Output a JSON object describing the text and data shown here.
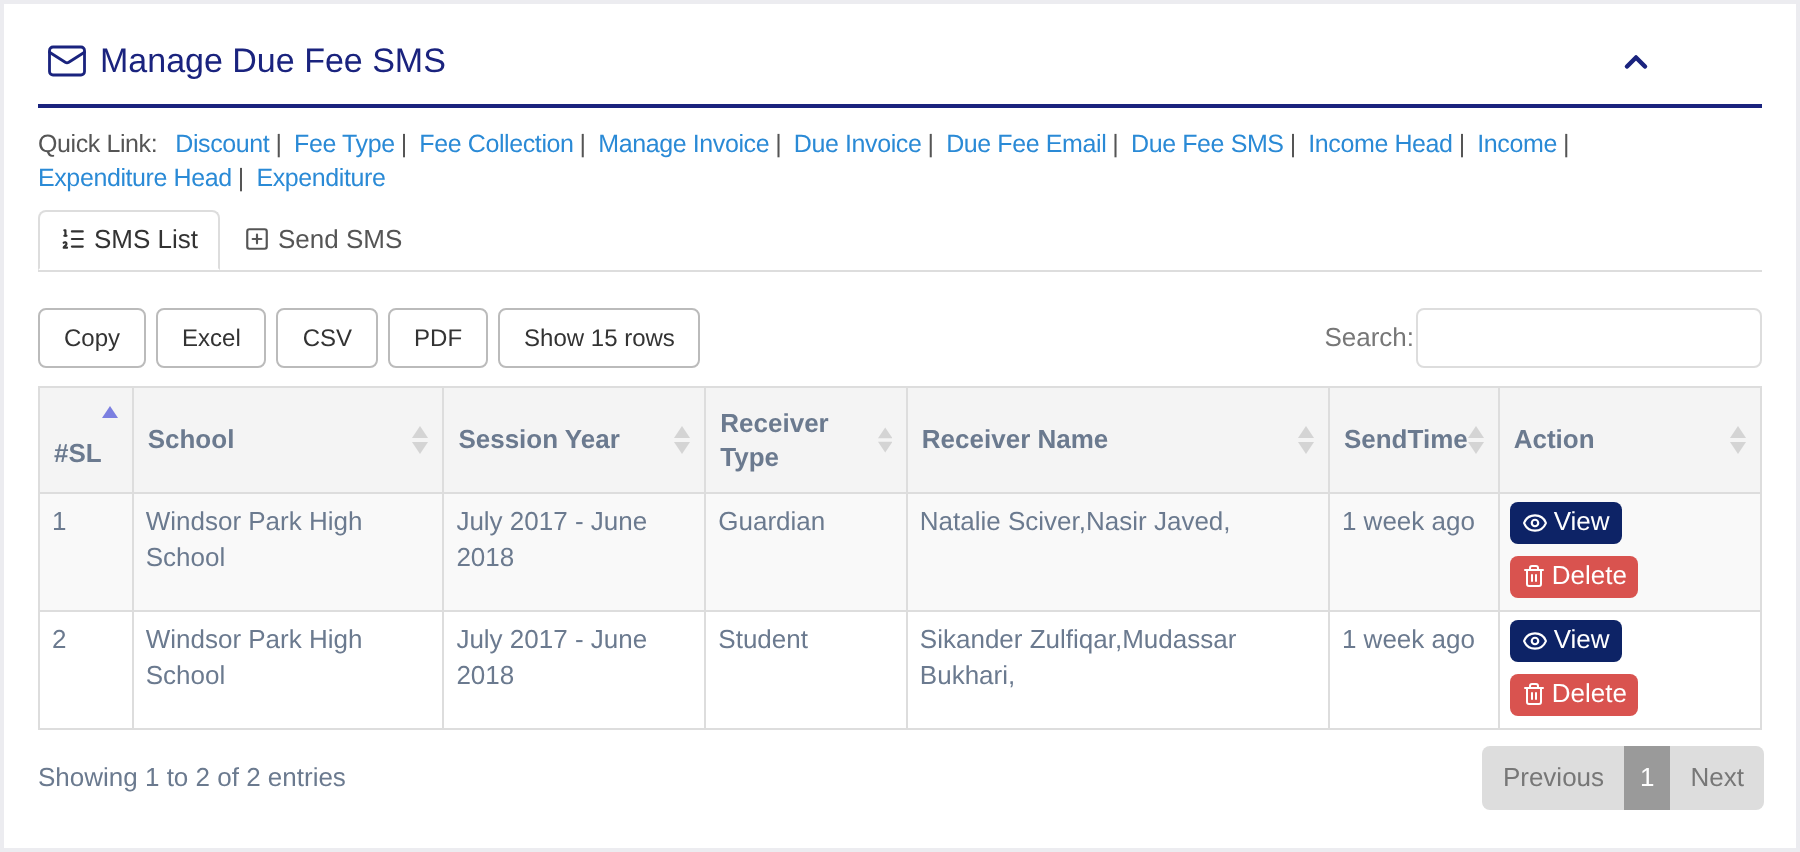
{
  "panel": {
    "title": "Manage Due Fee SMS",
    "expanded": true
  },
  "quick_links": {
    "label": "Quick Link:",
    "separator": "|",
    "links": [
      "Discount",
      "Fee Type",
      "Fee Collection",
      "Manage Invoice",
      "Due Invoice",
      "Due Fee Email",
      "Due Fee SMS",
      "Income Head",
      "Income",
      "Expenditure Head",
      "Expenditure"
    ]
  },
  "tabs": [
    {
      "label": "SMS List",
      "kind": "list",
      "selected": true
    },
    {
      "label": "Send SMS",
      "kind": "add",
      "selected": false
    }
  ],
  "export_buttons": [
    "Copy",
    "Excel",
    "CSV",
    "PDF",
    "Show 15 rows"
  ],
  "search": {
    "label": "Search:"
  },
  "table": {
    "columns": [
      {
        "label": "#SL",
        "sorted": true
      },
      {
        "label": "School",
        "sorted": false
      },
      {
        "label": "Session Year",
        "sorted": false
      },
      {
        "label": "Receiver Type",
        "sorted": false
      },
      {
        "label": "Receiver Name",
        "sorted": false
      },
      {
        "label": "SendTime",
        "sorted": false
      },
      {
        "label": "Action",
        "sorted": false
      }
    ],
    "rows": [
      {
        "cells": [
          "1",
          "Windsor Park High School",
          "July 2017 - June 2018",
          "Guardian",
          "Natalie Sciver,Nasir Javed,",
          "1 week ago"
        ],
        "actions": [
          "View",
          "Delete"
        ]
      },
      {
        "cells": [
          "2",
          "Windsor Park High School",
          "July 2017 - June 2018",
          "Student",
          "Sikander Zulfiqar,Mudassar Bukhari,",
          "1 week ago"
        ],
        "actions": [
          "View",
          "Delete"
        ]
      }
    ]
  },
  "footer": {
    "info": "Showing 1 to 2 of 2 entries",
    "pagination": {
      "previous": "Previous",
      "page": "1",
      "next": "Next",
      "disabled": true
    }
  }
}
